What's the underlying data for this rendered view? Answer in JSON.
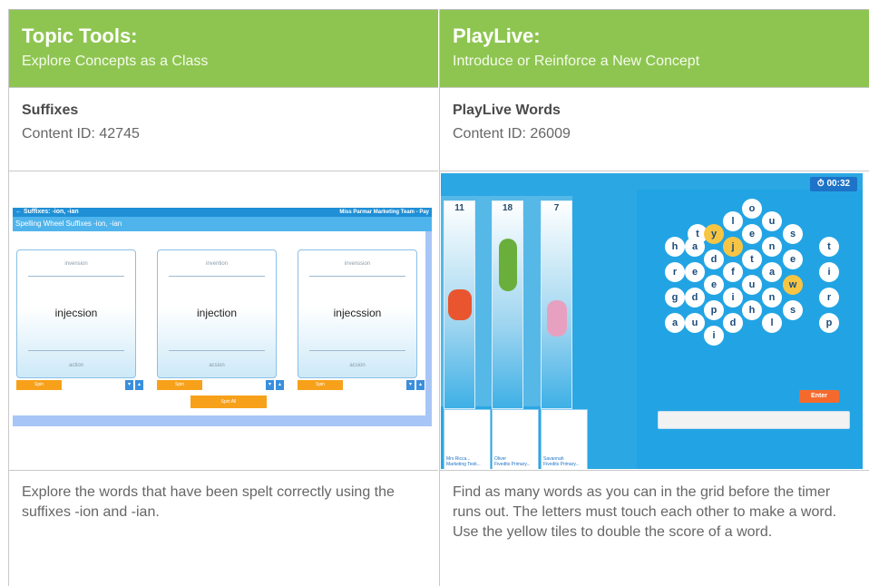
{
  "left": {
    "header_title": "Topic Tools:",
    "header_subtitle": "Explore Concepts as a Class",
    "resource_name": "Suffixes",
    "content_id": "Content ID: 42745",
    "description": "Explore the words that have been spelt correctly using the suffixes -ion and -ian.",
    "screenshot": {
      "app_bar_title": "← Suffixes: -ion, -ian",
      "user_name": "Miss Parmar",
      "user_school": "Marketing Team - Pay",
      "activity_title": "Spelling Wheel Suffixes -ion, -ian",
      "cards": [
        {
          "top": "invension",
          "word": "injecsion",
          "bottom": "action",
          "spin": "Spin"
        },
        {
          "top": "invention",
          "word": "injection",
          "bottom": "acsion",
          "spin": "Spin"
        },
        {
          "top": "invenssion",
          "word": "injecssion",
          "bottom": "acsion",
          "spin": "Spin"
        }
      ],
      "spin_all": "Spin All"
    }
  },
  "right": {
    "header_title": "PlayLive:",
    "header_subtitle": "Introduce or Reinforce a New Concept",
    "resource_name": "PlayLive Words",
    "content_id": "Content ID: 26009",
    "description": "Find as many words as you can in the grid before the timer runs out. The letters must touch each other to make a word. Use the yellow tiles to double the score of a word.",
    "screenshot": {
      "timer": "⏱ 00:32",
      "lanes": [
        "11",
        "18",
        "7"
      ],
      "players": [
        {
          "name": "Mrs Ricca...",
          "school": "Marketing Testi..."
        },
        {
          "name": "Oliver",
          "school": "Fivedits Primary..."
        },
        {
          "name": "Savannah",
          "school": "Fivedits Primary..."
        }
      ],
      "enter_label": "Enter",
      "letters": [
        "o",
        "l",
        "u",
        "t",
        "y",
        "e",
        "s",
        "h",
        "a",
        "j",
        "n",
        "t",
        "d",
        "t",
        "e",
        "r",
        "e",
        "f",
        "a",
        "i",
        "e",
        "u",
        "w",
        "g",
        "d",
        "i",
        "n",
        "r",
        "p",
        "h",
        "s",
        "a",
        "u",
        "d",
        "l",
        "p",
        "i"
      ],
      "yellow_tiles": [
        "y",
        "j",
        "w"
      ]
    }
  }
}
